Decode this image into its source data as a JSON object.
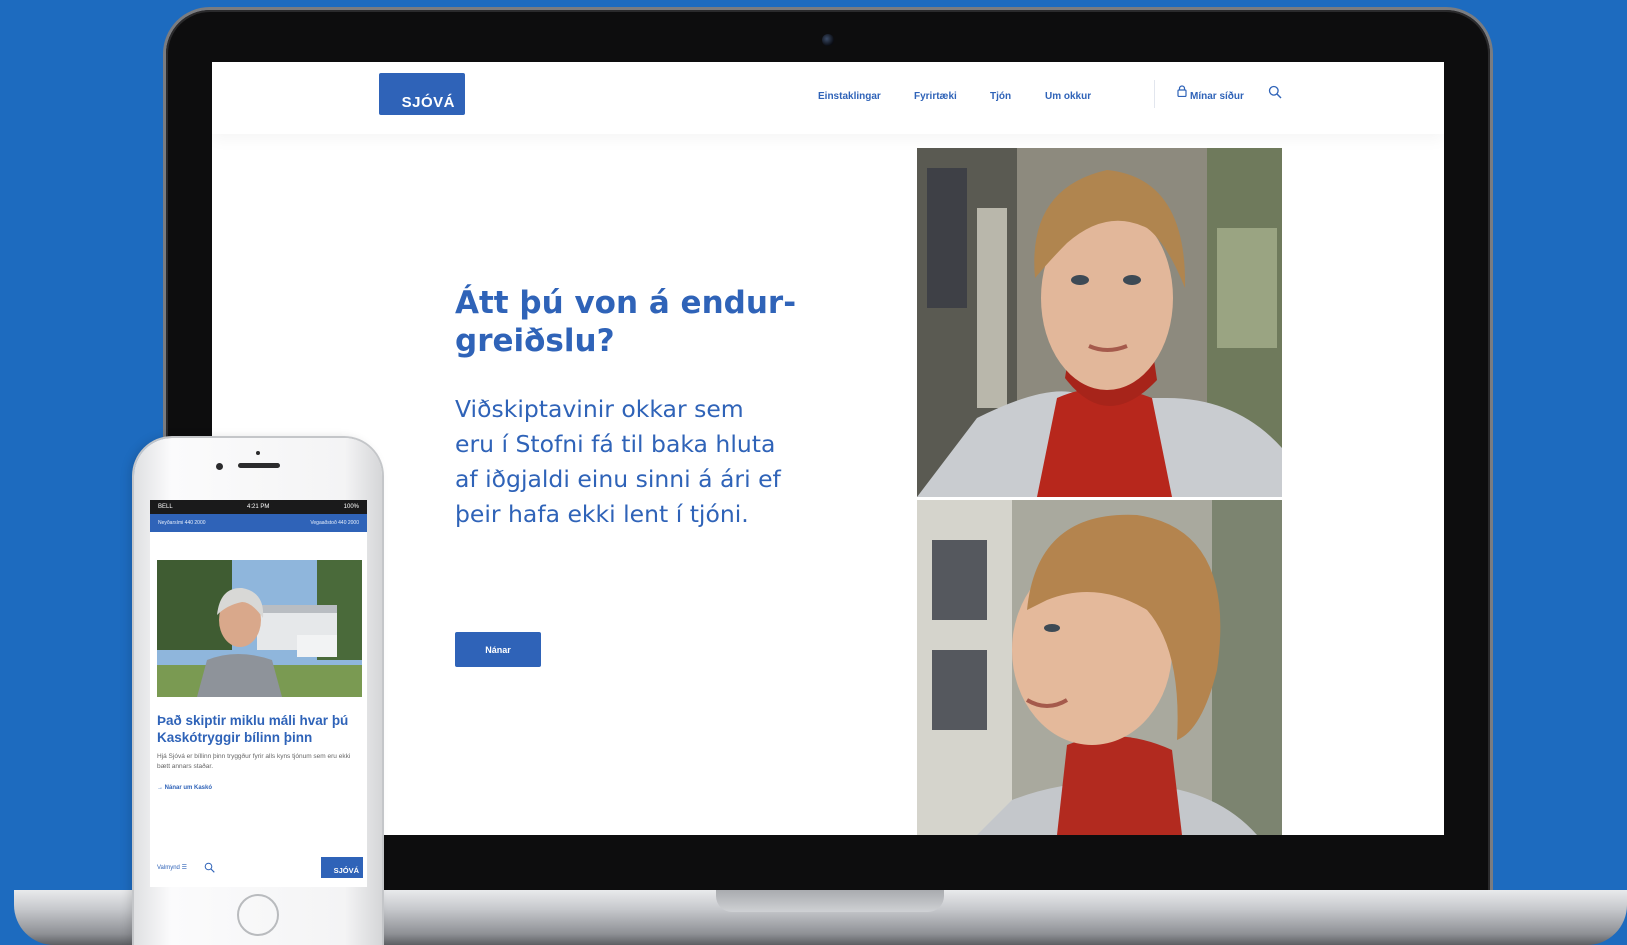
{
  "desktop": {
    "logo_text": "SJÓVÁ",
    "nav": {
      "items": [
        "Einstaklingar",
        "Fyrirtæki",
        "Tjón",
        "Um okkur"
      ],
      "login_label": "Mínar síður",
      "search_icon": "search-icon",
      "lock_icon": "lock-icon"
    },
    "hero": {
      "title_line1": "Átt þú von á endur-",
      "title_line2": "greiðslu?",
      "text_lines": [
        "Viðskiptavinir okkar sem",
        "eru í Stofni fá til baka hluta",
        "af iðgjaldi einu sinni á ári ef",
        "þeir hafa ekki lent í tjóni."
      ],
      "button_label": "Nánar"
    }
  },
  "mobile": {
    "status_bar": {
      "carrier": "BELL",
      "time": "4:21 PM",
      "battery": "100%"
    },
    "topbar": {
      "left": "Neyðarsími 440 2000",
      "right": "Vegaaðstoð 440 2000"
    },
    "article": {
      "title_line1": "Það skiptir miklu máli hvar þú",
      "title_line2": "Kaskótryggir bílinn þinn",
      "body": "Hjá Sjóvá er bíllinn þinn tryggður fyrir alls kyns tjónum sem eru ekki bætt annars staðar.",
      "link_label": "→ Nánar um Kaskó"
    },
    "bottom_bar": {
      "menu_label": "Valmynd ☰",
      "logo_text": "SJÓVÁ"
    }
  },
  "colors": {
    "background": "#1d6bbf",
    "brand_blue": "#2f63b8",
    "white": "#ffffff"
  }
}
